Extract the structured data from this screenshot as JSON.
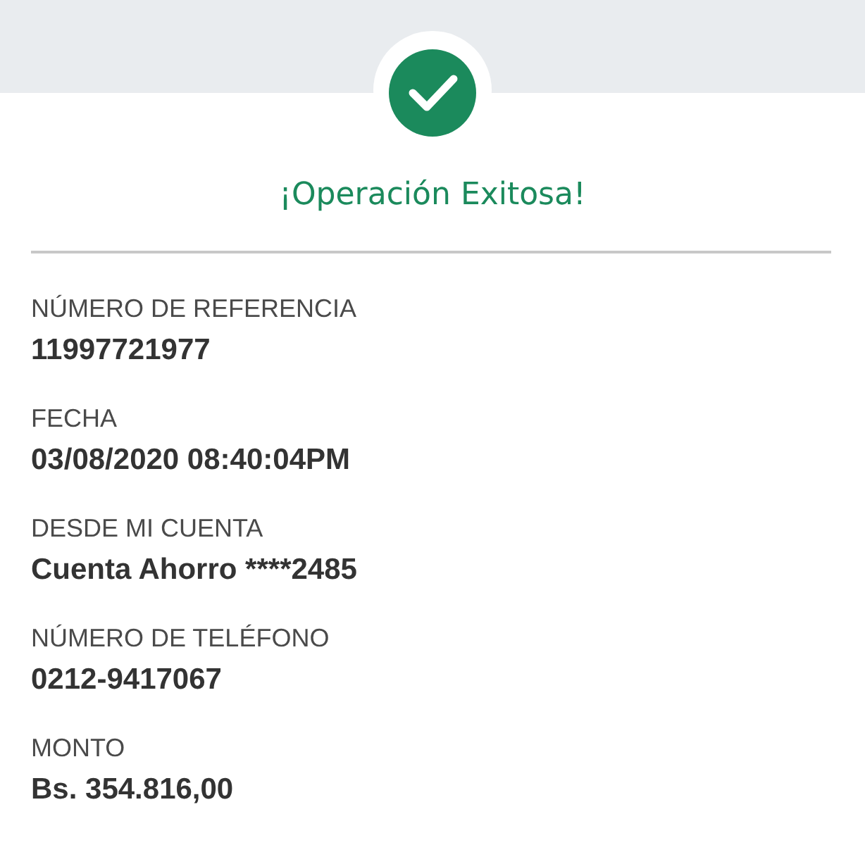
{
  "title": "¡Operación Exitosa!",
  "fields": [
    {
      "label": "NÚMERO DE REFERENCIA",
      "value": "11997721977"
    },
    {
      "label": "FECHA",
      "value": "03/08/2020 08:40:04PM"
    },
    {
      "label": "DESDE MI CUENTA",
      "value": "Cuenta Ahorro ****2485"
    },
    {
      "label": "NÚMERO DE TELÉFONO",
      "value": "0212-9417067"
    },
    {
      "label": "MONTO",
      "value": "Bs. 354.816,00"
    }
  ]
}
